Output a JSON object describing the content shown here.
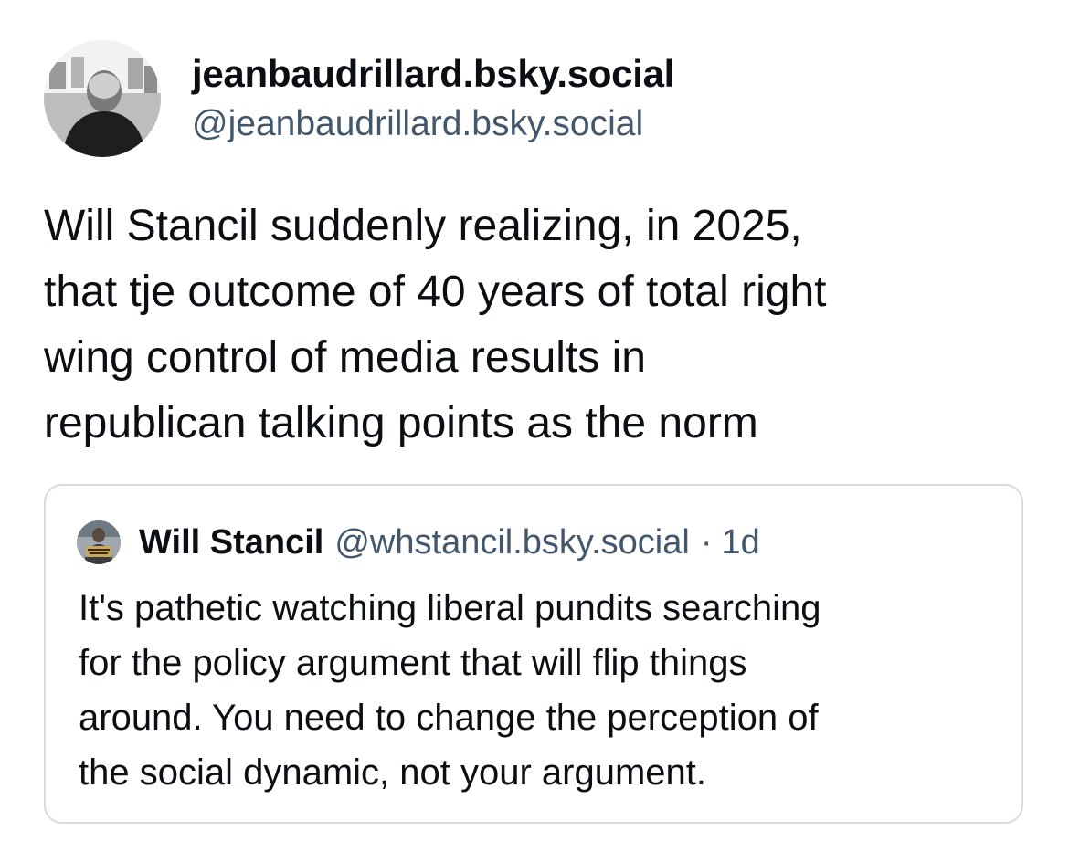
{
  "post": {
    "author": {
      "display_name": "jeanbaudrillard.bsky.social",
      "handle": "@jeanbaudrillard.bsky.social",
      "avatar_icon": "user-photo-avatar"
    },
    "text": "Will Stancil suddenly realizing, in 2025,\nthat tje outcome of 40 years of total right\nwing control of media results in\nrepublican talking points as the norm"
  },
  "quote": {
    "author": {
      "display_name": "Will Stancil",
      "handle": "@whstancil.bsky.social",
      "separator": "·",
      "time": "1d",
      "avatar_icon": "user-photo-avatar"
    },
    "text": "It's pathetic watching liberal pundits searching\nfor the policy argument that will flip things\naround. You need to change the perception of\nthe social dynamic, not your argument."
  },
  "colors": {
    "text": "#0b0f14",
    "secondary": "#42576c",
    "border": "#d4dbe2",
    "background": "#ffffff"
  }
}
